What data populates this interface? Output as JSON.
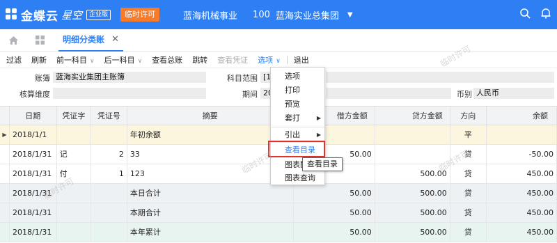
{
  "header": {
    "logo_text": "金蝶云",
    "logo_sub": "星空",
    "edition": "企业版",
    "temp_license": "临时许可",
    "org": "蓝海机械事业",
    "org_code": "100",
    "org_name": "蓝海实业总集团",
    "accent_color": "#2d7ff3"
  },
  "tabs": {
    "active_label": "明细分类账"
  },
  "toolbar": {
    "filter": "过滤",
    "refresh": "刷新",
    "prev_account": "前一科目",
    "next_account": "后一科目",
    "view_general_ledger": "查看总账",
    "jump": "跳转",
    "view_voucher": "查看凭证",
    "options": "选项",
    "exit": "退出"
  },
  "filter": {
    "book_label": "账簿",
    "book_value": "蓝海实业集团主账簿",
    "account_range_label": "科目范围",
    "account_range_value": "[10",
    "dimension_label": "核算维度",
    "period_label": "期间",
    "period_value": "20",
    "currency_label": "币别",
    "currency_value": "人民币"
  },
  "table": {
    "headers": [
      "日期",
      "凭证字",
      "凭证号",
      "摘要",
      "借方金额",
      "贷方金额",
      "方向",
      "余额"
    ],
    "rows": [
      {
        "date": "2018/1/1",
        "vtype": "",
        "vno": "",
        "summary": "年初余额",
        "debit": "",
        "credit": "",
        "dir": "平",
        "balance": ""
      },
      {
        "date": "2018/1/31",
        "vtype": "记",
        "vno": "2",
        "summary": "33",
        "debit": "50.00",
        "credit": "",
        "dir": "贷",
        "balance": "-50.00"
      },
      {
        "date": "2018/1/31",
        "vtype": "付",
        "vno": "1",
        "summary": "123",
        "debit": "",
        "credit": "500.00",
        "dir": "贷",
        "balance": "450.00"
      },
      {
        "date": "2018/1/31",
        "vtype": "",
        "vno": "",
        "summary": "本日合计",
        "debit": "50.00",
        "credit": "500.00",
        "dir": "贷",
        "balance": "450.00"
      },
      {
        "date": "2018/1/31",
        "vtype": "",
        "vno": "",
        "summary": "本期合计",
        "debit": "50.00",
        "credit": "500.00",
        "dir": "贷",
        "balance": "450.00"
      },
      {
        "date": "2018/1/31",
        "vtype": "",
        "vno": "",
        "summary": "本年累计",
        "debit": "50.00",
        "credit": "500.00",
        "dir": "贷",
        "balance": "450.00"
      }
    ]
  },
  "menu": {
    "items": [
      "选项",
      "打印",
      "预览",
      "套打",
      "引出",
      "查看目录",
      "图表配置",
      "图表查询"
    ],
    "covered_item_visible": "图表配"
  },
  "tooltip": "查看目录",
  "watermark": "临时许可"
}
